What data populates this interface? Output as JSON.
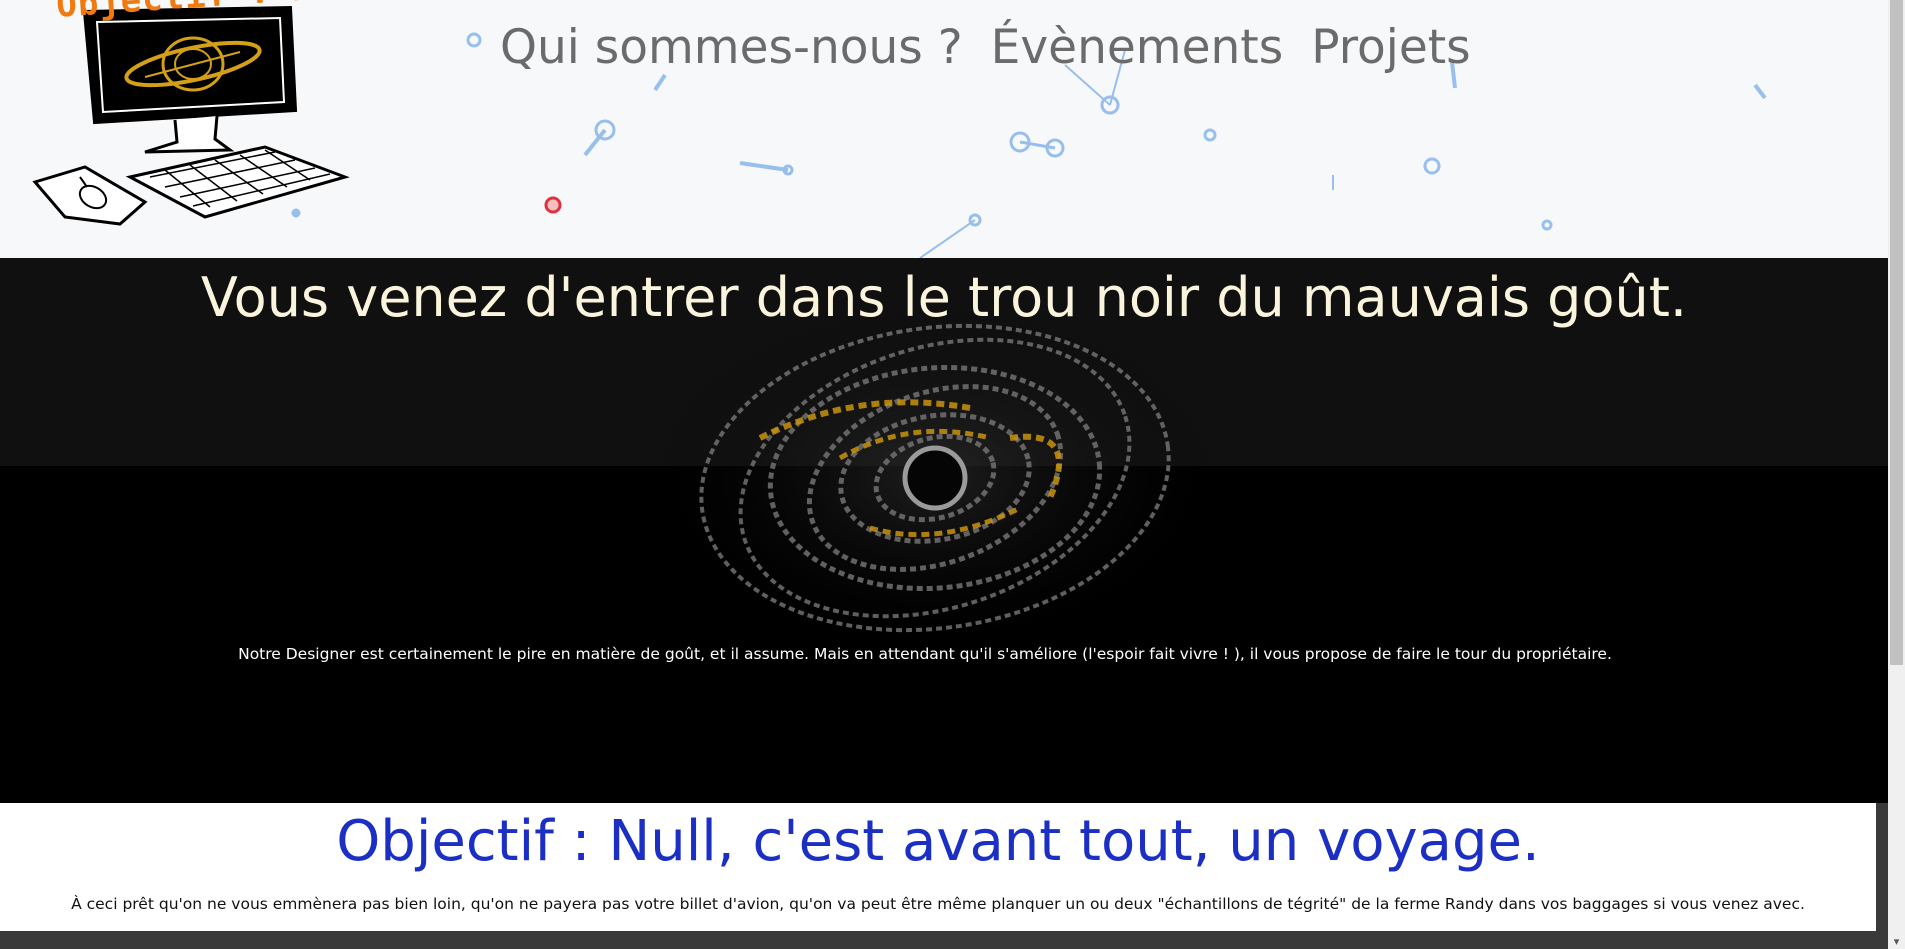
{
  "header": {
    "logo_text": "Objectif : NULL",
    "nav": [
      {
        "label": "Qui sommes-nous ?"
      },
      {
        "label": "Évènements"
      },
      {
        "label": "Projets"
      }
    ]
  },
  "hero": {
    "title": "Vous venez d'entrer dans le trou noir du mauvais goût.",
    "text": "Notre Designer est certainement le pire en matière de goût, et il assume. Mais en attendant qu'il s'améliore (l'espoir fait vivre ! ), il vous propose de faire le tour du propriétaire."
  },
  "intro": {
    "title": "Objectif : Null, c'est avant tout, un voyage.",
    "text": "À ceci prêt qu'on ne vous emmènera pas bien loin, qu'on ne payera pas votre billet d'avion, qu'on va peut être même planquer un ou deux \"échantillons de tégrité\" de la ferme Randy dans vos baggages si vous venez avec."
  },
  "colors": {
    "accent_blue": "#1b2fc4",
    "logo_orange": "#f07a10",
    "nav_gray": "#6b6b6b",
    "hero_title": "#fbf4dc",
    "particle_blue": "#4a90e2",
    "particle_red": "#e0303a"
  },
  "icons": [
    "computer-logo-icon",
    "particle-network-icon",
    "black-hole-galaxy-icon",
    "scroll-down-arrow-icon"
  ]
}
